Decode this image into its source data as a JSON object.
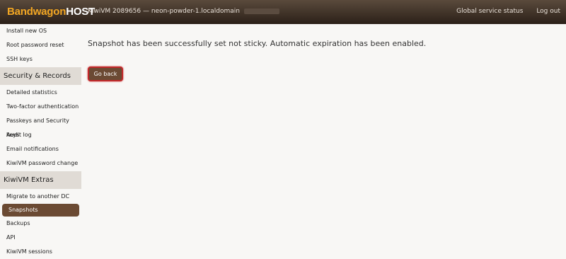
{
  "brand": {
    "part1": "Bandwagon",
    "part2": "HOST"
  },
  "header": {
    "vm_title": "KiwiVM 2089656 — neon-powder-1.localdomain",
    "links": [
      "Global service status",
      "Log out"
    ]
  },
  "sidebar": {
    "items_top": [
      "Install new OS",
      "Root password reset",
      "SSH keys"
    ],
    "section1": "Security & Records",
    "items_security": [
      "Detailed statistics",
      "Two-factor authentication",
      "Passkeys and Security keys",
      "Audit log",
      "Email notifications",
      "KiwiVM password change"
    ],
    "section2": "KiwiVM Extras",
    "items_extras": [
      "Migrate to another DC",
      "Snapshots",
      "Backups",
      "API",
      "KiwiVM sessions"
    ]
  },
  "main": {
    "message": "Snapshot has been successfully set not sticky. Automatic expiration has been enabled.",
    "back_button": "Go back"
  }
}
